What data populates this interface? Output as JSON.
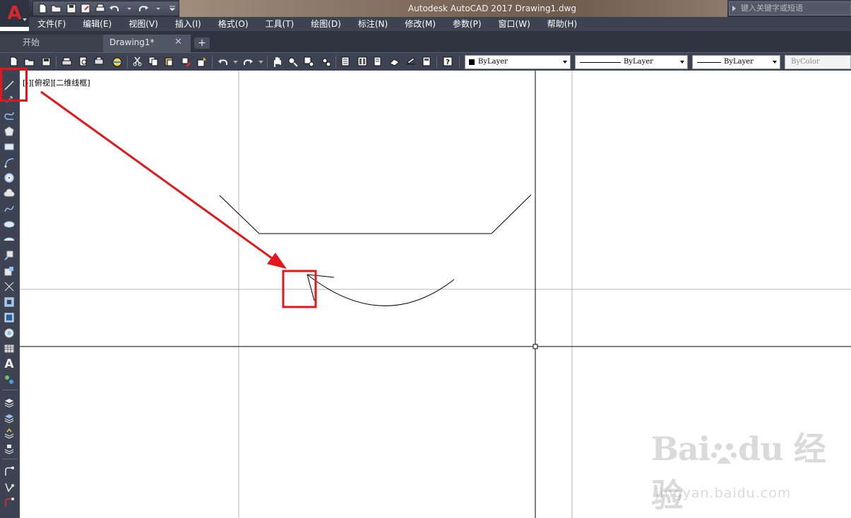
{
  "window": {
    "title": "Autodesk AutoCAD 2017    Drawing1.dwg",
    "search_placeholder": "键入关键字或短语",
    "logo_letter": "A"
  },
  "menu": {
    "items": [
      "文件(F)",
      "编辑(E)",
      "视图(V)",
      "插入(I)",
      "格式(O)",
      "工具(T)",
      "绘图(D)",
      "标注(N)",
      "修改(M)",
      "参数(P)",
      "窗口(W)",
      "帮助(H)"
    ]
  },
  "tabs": {
    "start_label": "开始",
    "drawing_label": "Drawing1*",
    "close_symbol": "✕",
    "add_symbol": "+"
  },
  "properties": {
    "color_label": "ByLayer",
    "linetype_label": "ByLayer",
    "lineweight_label": "ByLayer",
    "plotstyle_label": "ByColor"
  },
  "viewport": {
    "label": "[-][俯视][二维线框]"
  },
  "left_toolbar": {
    "text_tool_glyph": "A"
  },
  "watermark": {
    "brand_prefix": "Bai",
    "brand_suffix": "du 经验",
    "url": "jingyan.baidu.com"
  },
  "colors": {
    "annotation_red": "#e5161b",
    "title_bar": "#2b303b",
    "ui_dark": "#3d4352",
    "logo_red": "#d8262c"
  },
  "icons": [
    "new-file-icon",
    "open-folder-icon",
    "save-icon",
    "save-as-icon",
    "print-icon",
    "undo-icon",
    "redo-icon",
    "line-tool-icon",
    "arc-tool-icon",
    "pan-hand-icon",
    "zoom-icon",
    "help-icon",
    "text-tool-icon"
  ]
}
